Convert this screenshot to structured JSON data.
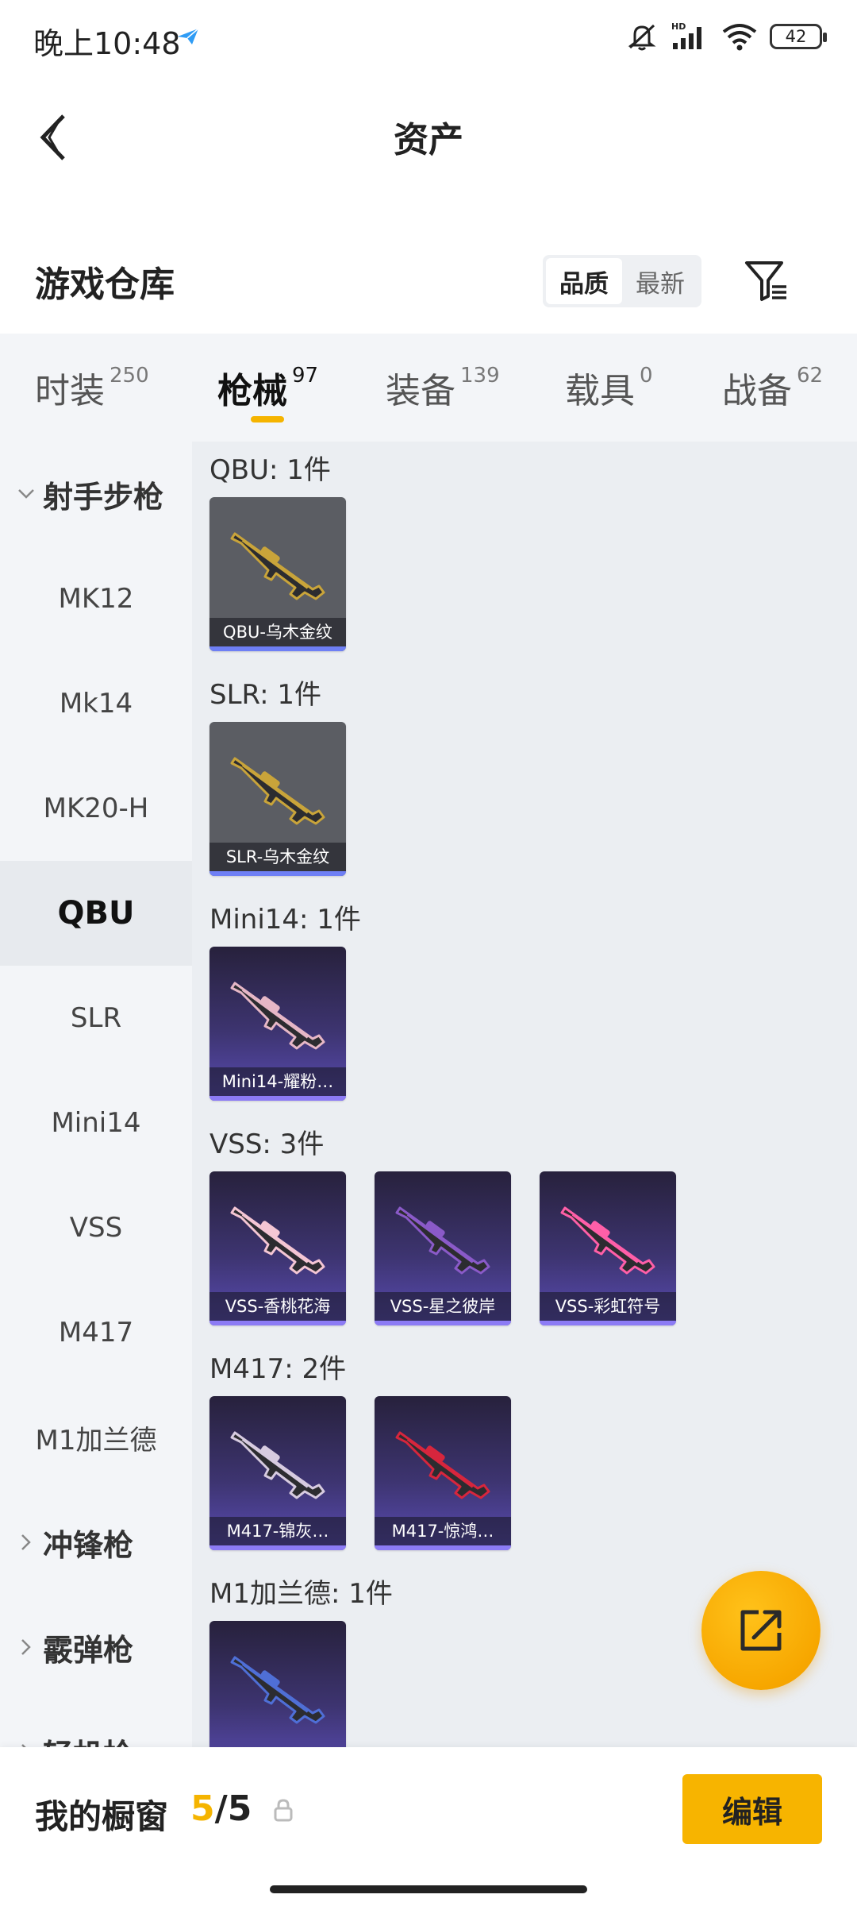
{
  "status_bar": {
    "time": "晚上10:48",
    "battery": "42",
    "icons": [
      "paper-plane-icon",
      "mute-icon",
      "hd-signal-icon",
      "wifi-icon",
      "battery-icon"
    ]
  },
  "header": {
    "title": "资产",
    "back_icon": "chevron-left-icon"
  },
  "section": {
    "title": "游戏仓库",
    "sort_options": [
      "品质",
      "最新"
    ],
    "selected_sort": "品质",
    "filter_icon": "filter-icon"
  },
  "tabs": [
    {
      "label": "时装",
      "count": "250"
    },
    {
      "label": "枪械",
      "count": "97"
    },
    {
      "label": "装备",
      "count": "139"
    },
    {
      "label": "载具",
      "count": "0"
    },
    {
      "label": "战备",
      "count": "62"
    }
  ],
  "active_tab": "枪械",
  "sidebar": {
    "group_expanded": "射手步枪",
    "items": [
      "MK12",
      "Mk14",
      "MK20-H",
      "QBU",
      "SLR",
      "Mini14",
      "VSS",
      "M417",
      "M1加兰德"
    ],
    "active_item": "QBU",
    "collapsed_groups": [
      "冲锋枪",
      "霰弹枪",
      "轻机枪"
    ]
  },
  "groups": [
    {
      "header": "QBU: 1件",
      "items": [
        {
          "name": "QBU-乌木金纹",
          "style": "gray",
          "gun_color": "#c9a43a"
        }
      ]
    },
    {
      "header": "SLR: 1件",
      "items": [
        {
          "name": "SLR-乌木金纹",
          "style": "gray",
          "gun_color": "#c9a43a"
        }
      ]
    },
    {
      "header": "Mini14: 1件",
      "items": [
        {
          "name": "Mini14-耀粉…",
          "style": "purple",
          "gun_color": "#e6b7c6"
        }
      ]
    },
    {
      "header": "VSS: 3件",
      "items": [
        {
          "name": "VSS-香桃花海",
          "style": "purple",
          "gun_color": "#f4c6d4"
        },
        {
          "name": "VSS-星之彼岸",
          "style": "purple",
          "gun_color": "#8a5ac8"
        },
        {
          "name": "VSS-彩虹符号",
          "style": "purple",
          "gun_color": "#ff5fa8"
        }
      ]
    },
    {
      "header": "M417: 2件",
      "items": [
        {
          "name": "M417-锦灰…",
          "style": "purple",
          "gun_color": "#d7cbe0"
        },
        {
          "name": "M417-惊鸿…",
          "style": "purple",
          "gun_color": "#d7263d"
        }
      ]
    },
    {
      "header": "M1加兰德: 1件",
      "items": [
        {
          "name": "",
          "style": "purple",
          "gun_color": "#4f6fd6"
        }
      ]
    }
  ],
  "share_icon": "share-icon",
  "bottom_bar": {
    "label": "我的橱窗",
    "count_current": "5",
    "count_sep": "/",
    "count_total": "5",
    "lock_icon": "lock-icon",
    "edit_label": "编辑"
  }
}
